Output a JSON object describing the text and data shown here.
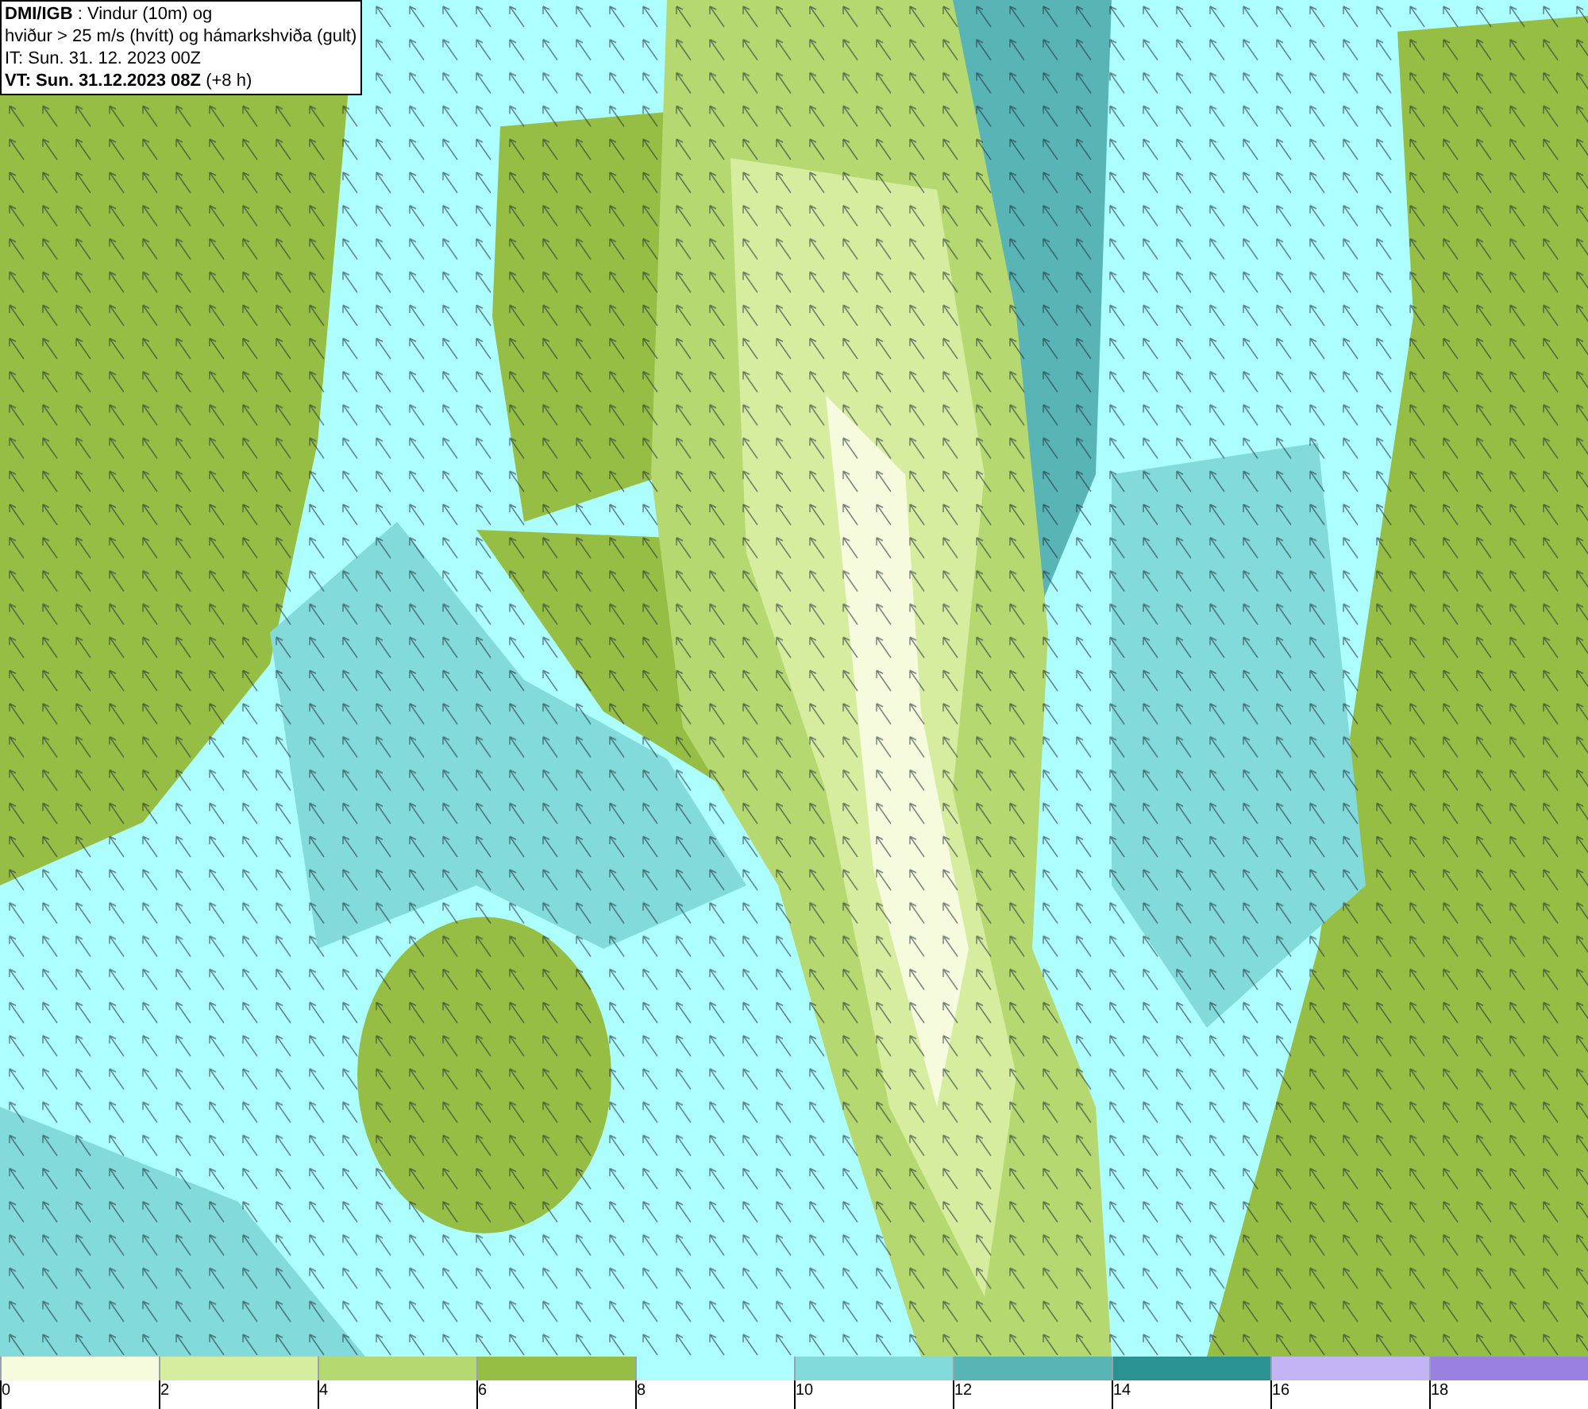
{
  "info_box": {
    "lines": [
      "**DMI/IGB** : Vindur (10m) og",
      "hviður > 25 m/s (hvítt) og hámarkshviða (gult)",
      "IT: Sun. 31. 12. 2023 00Z",
      "**VT: Sun. 31.12.2023 08Z** (+8 h)"
    ]
  },
  "legend": [
    {
      "color": "#f5fbdc",
      "label": "0"
    },
    {
      "color": "#d6eda0",
      "label": "2"
    },
    {
      "color": "#b5d870",
      "label": "4"
    },
    {
      "color": "#96be45",
      "label": "6"
    },
    {
      "color": "#adfefe",
      "label": "8"
    },
    {
      "color": "#82dada",
      "label": "10"
    },
    {
      "color": "#59b5b5",
      "label": "12"
    },
    {
      "color": "#2a9290",
      "label": "14"
    },
    {
      "color": "#c3b5f5",
      "label": "16"
    },
    {
      "color": "#9a80e0",
      "label": "18"
    }
  ]
}
